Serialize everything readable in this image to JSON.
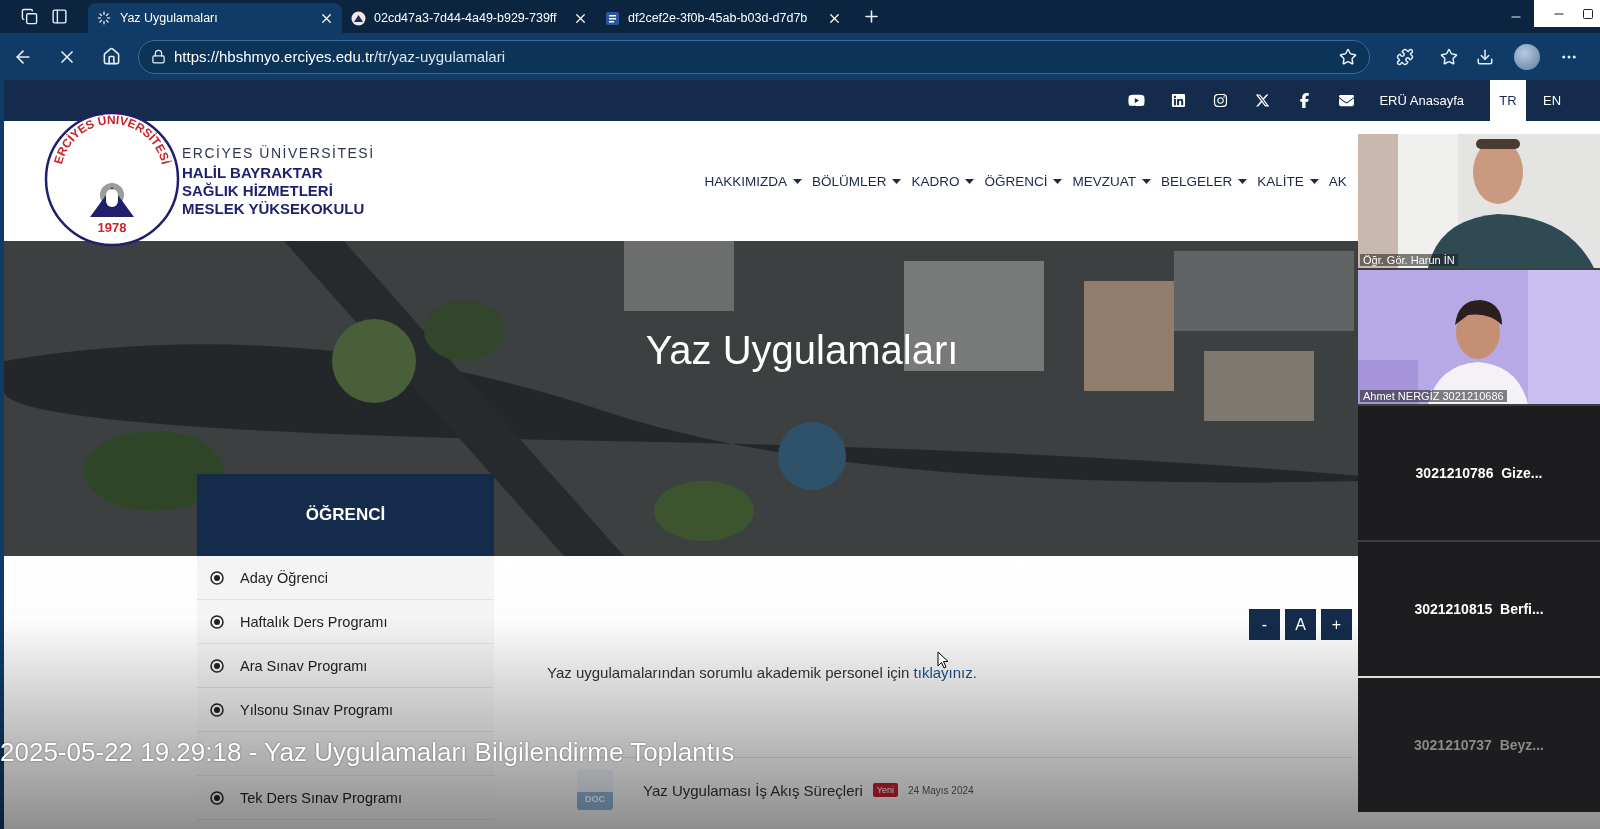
{
  "browser": {
    "tabs": [
      {
        "title": "Yaz Uygulamaları",
        "selected": true,
        "kind": "loading"
      },
      {
        "title": "02cd47a3-7d44-4a49-b929-739ff",
        "selected": false,
        "kind": "web"
      },
      {
        "title": "df2cef2e-3f0b-45ab-b03d-d7d7b",
        "selected": false,
        "kind": "word"
      }
    ],
    "url_host": "https://hbshmyo.erciyes.edu.tr",
    "url_path": "/tr/yaz-uygulamalari"
  },
  "site": {
    "topbar": {
      "home_link": "ERÜ Anasayfa",
      "languages": [
        {
          "label": "TR",
          "selected": true
        },
        {
          "label": "EN",
          "selected": false
        }
      ]
    },
    "logo": {
      "ring_text": "ERCİYES ÜNİVERSİTESİ",
      "year": "1978"
    },
    "brand": {
      "university": "ERCİYES ÜNİVERSİTESİ",
      "school_lines": [
        "HALİL BAYRAKTAR",
        "SAĞLIK HİZMETLERİ",
        "MESLEK YÜKSEKOKULU"
      ]
    },
    "nav": [
      {
        "label": "HAKKIMIZDA",
        "dropdown": true
      },
      {
        "label": "BÖLÜMLER",
        "dropdown": true
      },
      {
        "label": "KADRO",
        "dropdown": true
      },
      {
        "label": "ÖĞRENCİ",
        "dropdown": true
      },
      {
        "label": "MEVZUAT",
        "dropdown": true
      },
      {
        "label": "BELGELER",
        "dropdown": true
      },
      {
        "label": "KALİTE",
        "dropdown": true
      },
      {
        "label": "AK",
        "dropdown": false
      }
    ],
    "hero_title": "Yaz Uygulamaları",
    "sidebar": {
      "title": "ÖĞRENCİ",
      "items": [
        {
          "kind": "link",
          "label": "Aday Öğrenci"
        },
        {
          "kind": "link",
          "label": "Haftalık Ders Programı"
        },
        {
          "kind": "link",
          "label": "Ara Sınav Programı"
        },
        {
          "kind": "link",
          "label": "Yılsonu Sınav Programı"
        },
        {
          "kind": "covered"
        },
        {
          "kind": "link",
          "label": "Tek Ders Sınav Programı"
        }
      ]
    },
    "font_controls": [
      "-",
      "A",
      "+"
    ],
    "intro": {
      "text": "Yaz uygulamalarından sorumlu akademik personel için ",
      "link": "tıklayınız."
    },
    "documents": [
      {
        "file_type": "DOC",
        "title": "Yaz Uygulaması İş Akış Süreçleri",
        "badge": "Yeni",
        "date": "24 Mayıs 2024"
      }
    ]
  },
  "meeting": {
    "participants": [
      {
        "kind": "video",
        "name": "Öğr. Gör. Harun İN"
      },
      {
        "kind": "video",
        "name": "Ahmet NERGİZ 3021210686"
      },
      {
        "kind": "avatar",
        "name": "3021210786  Gize...",
        "dimmed": false
      },
      {
        "kind": "avatar",
        "name": "3021210815  Berfi...",
        "dimmed": false
      },
      {
        "kind": "avatar",
        "name": "3021210737  Beyz...",
        "dimmed": true
      }
    ],
    "caption": "2025-05-22 19.29:18 - Yaz Uygulamaları Bilgilendirme Toplantıs"
  }
}
